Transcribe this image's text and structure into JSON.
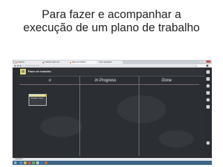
{
  "slide": {
    "title_line1": "Para fazer e acompanhar a",
    "title_line2": "execução de um plano de trabalho"
  },
  "browser": {
    "tabs": [
      {
        "label": "Trabalho",
        "active": false
      },
      {
        "label": "Trabalho plano de...",
        "active": false
      },
      {
        "label": "Plano de trabalho",
        "active": true
      },
      {
        "label": "Novo separador",
        "active": false
      }
    ],
    "url": "pt.linoit.com/users/...",
    "status": "A aguardar..."
  },
  "board": {
    "title": "Plano de trabalho",
    "columns": [
      {
        "label": "o"
      },
      {
        "label": "In Progress"
      },
      {
        "label": "Done"
      }
    ],
    "sticky": {
      "text": "Atividade / Tarefa"
    }
  },
  "taskbar": {
    "time": "",
    "date": ""
  },
  "colors": {
    "board_bg": "#2b2f34",
    "grid_line": "#7d6a78",
    "sticky_accent": "#e6e2a0",
    "taskbar": "#3a6486"
  },
  "icons": [
    "star-icon",
    "menu-icon",
    "windows-start-icon",
    "tool-icons"
  ]
}
